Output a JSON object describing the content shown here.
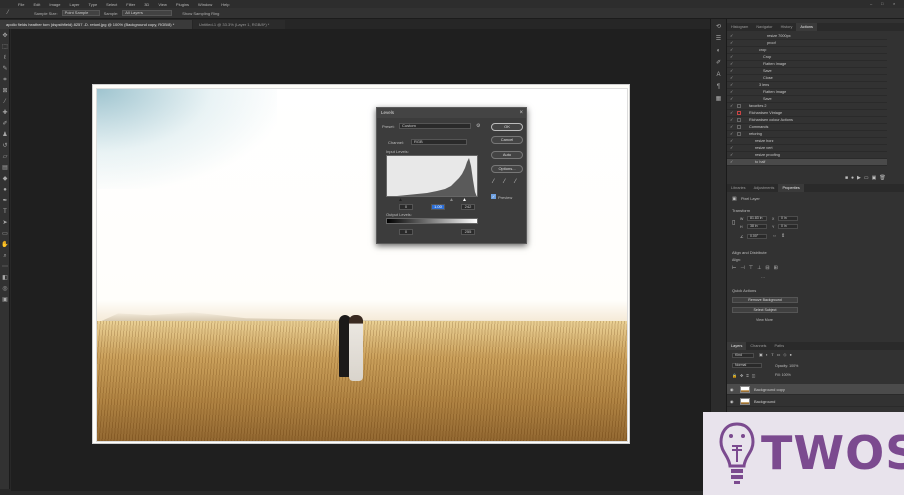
{
  "app": {
    "menu": [
      "File",
      "Edit",
      "Image",
      "Layer",
      "Type",
      "Select",
      "Filter",
      "3D",
      "View",
      "Plugins",
      "Window",
      "Help"
    ]
  },
  "options_bar": {
    "sample_size_label": "Sample Size:",
    "sample_size_value": "Point Sample",
    "sample_label": "Sample:",
    "sample_value": "All Layers",
    "show_ring_label": "Show Sampling Ring"
  },
  "tabs": [
    {
      "label": "apollo fields heather tom (dspsthfield) 8257 -D. retonl.jpg @ 100% (Background copy, RGB/8) *",
      "active": true
    },
    {
      "label": "Untitled-1 @ 33.3% (Layer 1, RGB/8*) *",
      "active": false
    }
  ],
  "levels": {
    "title": "Levels",
    "preset_label": "Preset:",
    "preset_value": "Custom",
    "channel_label": "Channel:",
    "channel_value": "RGB",
    "input_levels_label": "Input Levels:",
    "input_black": "0",
    "input_mid": "1.00",
    "input_white": "242",
    "output_levels_label": "Output Levels:",
    "output_black": "0",
    "output_white": "255",
    "buttons": {
      "ok": "OK",
      "cancel": "Cancel",
      "auto": "Auto",
      "options": "Options..."
    },
    "preview_label": "Preview",
    "preview_checked": true
  },
  "actions_panel": {
    "tabs": [
      "Histogram",
      "Navigator",
      "History",
      "Actions"
    ],
    "active_tab": "Actions",
    "rows": [
      "resize 7000px",
      "proof",
      "crop",
      "Crop",
      "Flatten Image",
      "Save",
      "Close",
      "3 lens",
      "Flatten Image",
      "Save",
      "favorites 2",
      "Richardsen Vintage",
      "Richardsen colour Actions",
      "Commands",
      "retoring",
      "resize horz",
      "resize vert",
      "resize proofing",
      "to half"
    ]
  },
  "properties_panel": {
    "tabs": [
      "Libraries",
      "Adjustments",
      "Properties"
    ],
    "active_tab": "Properties",
    "pixel_layer_label": "Pixel Layer",
    "transform_label": "Transform",
    "w_value": "81.83 in",
    "h_value": "38 in",
    "x_value": "0 in",
    "y_value": "0 in",
    "angle_value": "0.00°",
    "align_label": "Align and Distribute",
    "align_sub": "Align:",
    "quick_actions_label": "Quick Actions",
    "remove_bg_label": "Remove Background",
    "select_subject_label": "Select Subject",
    "view_more_label": "View More"
  },
  "layers_panel": {
    "tabs": [
      "Layers",
      "Channels",
      "Paths"
    ],
    "active_tab": "Layers",
    "kind_label": "Kind",
    "blend_mode": "Normal",
    "opacity_label": "Opacity: 100%",
    "fill_label": "Fill: 100%",
    "layers": [
      {
        "name": "Background copy",
        "selected": true
      },
      {
        "name": "Background",
        "selected": false
      }
    ]
  },
  "logo": {
    "text": "TWOS"
  }
}
